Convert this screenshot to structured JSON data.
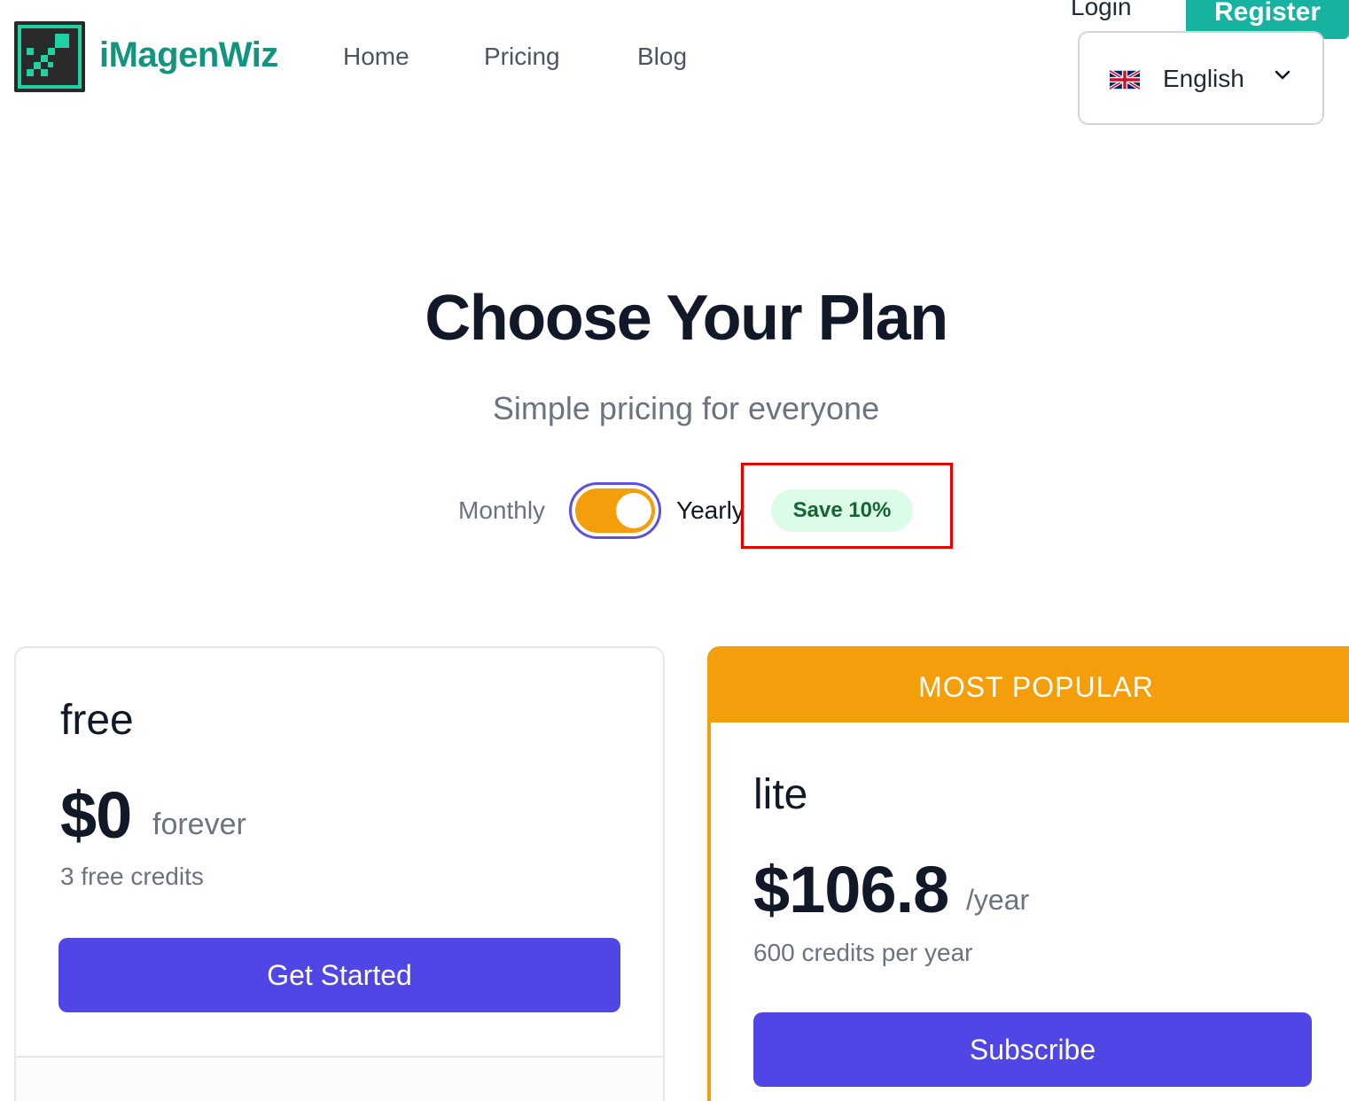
{
  "header": {
    "brand": "iMagenWiz",
    "nav": [
      "Home",
      "Pricing",
      "Blog"
    ],
    "login": "Login",
    "register": "Register",
    "language": "English"
  },
  "hero": {
    "title": "Choose Your Plan",
    "subtitle": "Simple pricing for everyone"
  },
  "billing": {
    "monthly": "Monthly",
    "yearly": "Yearly",
    "selected": "Yearly",
    "save_badge": "Save 10%"
  },
  "plans": [
    {
      "name": "free",
      "price": "$0",
      "period": "forever",
      "credits": "3 free credits",
      "cta": "Get Started"
    },
    {
      "badge": "MOST POPULAR",
      "name": "lite",
      "price": "$106.8",
      "period": "/year",
      "credits": "600 credits per year",
      "cta": "Subscribe"
    }
  ],
  "colors": {
    "brand": "#14937f",
    "accent": "#4f46e5",
    "popular": "#f59e0b",
    "save_bg": "#dcfce7",
    "highlight": "#e50000"
  },
  "icons": [
    "logo-icon",
    "uk-flag-icon",
    "chevron-down-icon"
  ]
}
